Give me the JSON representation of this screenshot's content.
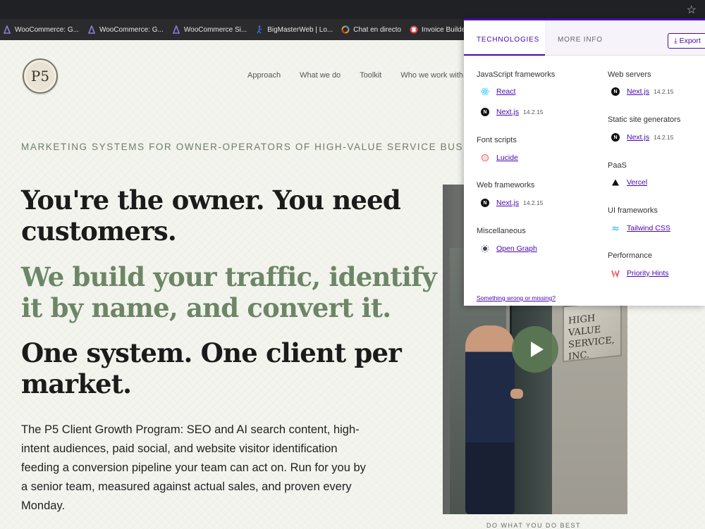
{
  "bookmarks": [
    {
      "label": "WooCommerce: G...",
      "icon": "woocommerce-icon",
      "color": "#7f54b3"
    },
    {
      "label": "WooCommerce: G...",
      "icon": "woocommerce-icon",
      "color": "#7f54b3"
    },
    {
      "label": "WooCommerce Si...",
      "icon": "woocommerce-icon",
      "color": "#7f54b3"
    },
    {
      "label": "BigMasterWeb | Lo...",
      "icon": "runner-icon",
      "color": "#3b6ed8"
    },
    {
      "label": "Chat en directo",
      "icon": "chat-ring-icon",
      "color": "#e2a22b"
    },
    {
      "label": "Invoice Builder | L...",
      "icon": "invoice-icon",
      "color": "#e14b4b"
    }
  ],
  "site": {
    "logo": "P5",
    "nav": [
      "Approach",
      "What we do",
      "Toolkit",
      "Who we work with"
    ],
    "eyebrow": "MARKETING SYSTEMS FOR OWNER-OPERATORS OF HIGH-VALUE SERVICE BUS",
    "headline_1": "You're the owner. You need customers.",
    "headline_2": "We build your traffic, identify it by name, and convert it.",
    "headline_3": "One system. One client per market.",
    "paragraph": "The P5 Client Growth Program: SEO and AI search content, high-intent audiences, paid social, and website visitor identification feeding a conversion pipeline your team can act on. Run for you by a senior team, measured against actual sales, and proven every Monday.",
    "video_sign": "HIGH VALUE SERVICE, INC.",
    "video_caption": "DO WHAT YOU DO BEST",
    "accent_green": "#6c8666"
  },
  "popup": {
    "tabs": {
      "technologies": "TECHNOLOGIES",
      "more_info": "MORE INFO"
    },
    "export_label": "Export",
    "accent": "#4608ad",
    "categories": {
      "js_frameworks": "JavaScript frameworks",
      "font_scripts": "Font scripts",
      "web_frameworks": "Web frameworks",
      "misc": "Miscellaneous",
      "web_servers": "Web servers",
      "ssg": "Static site generators",
      "paas": "PaaS",
      "ui_frameworks": "UI frameworks",
      "performance": "Performance"
    },
    "techs": {
      "react": {
        "name": "React"
      },
      "nextjs_js": {
        "name": "Next.js",
        "version": "14.2.15"
      },
      "lucide": {
        "name": "Lucide"
      },
      "nextjs_web": {
        "name": "Next.js",
        "version": "14.2.15"
      },
      "open_graph": {
        "name": "Open Graph"
      },
      "nextjs_server": {
        "name": "Next.js",
        "version": "14.2.15"
      },
      "nextjs_ssg": {
        "name": "Next.js",
        "version": "14.2.15"
      },
      "vercel": {
        "name": "Vercel"
      },
      "tailwind": {
        "name": "Tailwind CSS"
      },
      "priority_hints": {
        "name": "Priority Hints"
      }
    },
    "footer_link": "Something wrong or missing?"
  }
}
